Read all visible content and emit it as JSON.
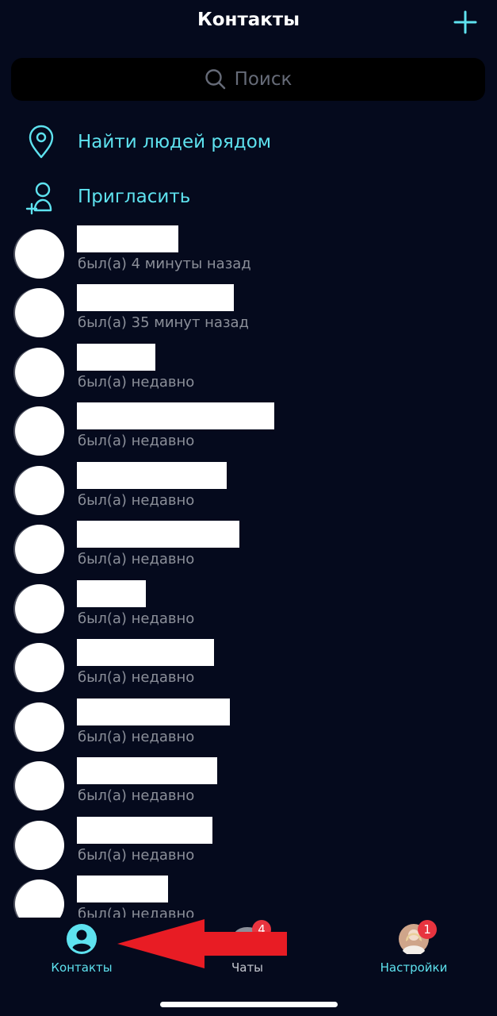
{
  "header": {
    "title": "Контакты",
    "add_icon": "plus-icon"
  },
  "search": {
    "placeholder": "Поиск",
    "icon": "search-icon"
  },
  "actions": [
    {
      "label": "Найти людей рядом",
      "icon": "location-pin-icon"
    },
    {
      "label": "Пригласить",
      "icon": "add-person-icon"
    }
  ],
  "contacts": [
    {
      "status": "был(а) 4 минуты назад"
    },
    {
      "status": "был(а) 35 минут назад"
    },
    {
      "status": "был(а) недавно"
    },
    {
      "status": "был(а) недавно"
    },
    {
      "status": "был(а) недавно"
    },
    {
      "status": "был(а) недавно"
    },
    {
      "status": "был(а) недавно"
    },
    {
      "status": "был(а) недавно"
    },
    {
      "status": "был(а) недавно"
    },
    {
      "status": "был(а) недавно"
    },
    {
      "status": "был(а) недавно"
    },
    {
      "status": "был(а) недавно"
    }
  ],
  "tabbar": {
    "contacts": {
      "label": "Контакты",
      "icon": "person-circle-icon"
    },
    "chats": {
      "label": "Чаты",
      "icon": "chat-bubble-icon",
      "badge": "4"
    },
    "settings": {
      "label": "Настройки",
      "icon": "profile-avatar",
      "badge": "1"
    }
  },
  "colors": {
    "background": "#050a1d",
    "accent": "#5ee2ef",
    "badge": "#e8343f",
    "status_text": "#8b8f99",
    "annotation_arrow": "#e81c24"
  }
}
